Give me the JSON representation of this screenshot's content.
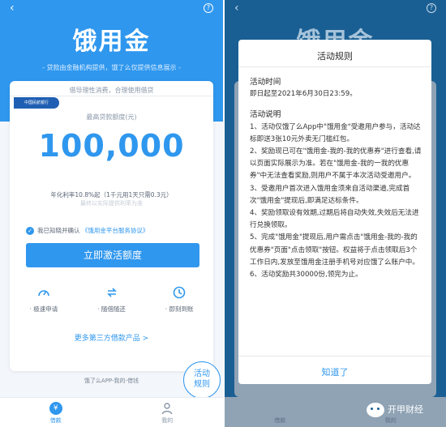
{
  "left": {
    "back_glyph": "‹",
    "help_glyph": "?",
    "app_name": "饿用金",
    "tagline": "- 贷款由金融机构提供，饿了么仅提供信息展示 -",
    "card": {
      "header": "借导理性消费，合理使用借贷",
      "partner_badge": "中国民航银行",
      "limit_label": "最高贷款额度(元)",
      "limit_amount": "100,000",
      "rate_line": "年化利率10.8%起（1千元用1天只需0.3元）",
      "rate_note": "最终以实际提供利率为准",
      "agree_prefix": "我已知晓并确认",
      "agree_link": "《饿用金平台服务协议》",
      "activate_button": "立即激活额度",
      "features": [
        {
          "label": "· 极速申请",
          "icon": "speed-icon"
        },
        {
          "label": "· 随借随还",
          "icon": "repeat-icon"
        },
        {
          "label": "· 即刻到账",
          "icon": "clock-icon"
        }
      ],
      "more_link": "更多第三方借款产品 >"
    },
    "footer_note": "饿了么APP-我的-借钱",
    "float_button": {
      "line1": "活动",
      "line2": "规则"
    },
    "tabs": [
      {
        "label": "借款",
        "icon": "yen-icon",
        "active": true
      },
      {
        "label": "我的",
        "icon": "person-icon",
        "active": false
      }
    ]
  },
  "right": {
    "back_glyph": "‹",
    "help_glyph": "?",
    "app_name": "饿用金",
    "tabs": [
      "借款",
      "我的"
    ],
    "modal": {
      "title": "活动规则",
      "time_title": "活动时间",
      "time_text": "即日起至2021年6月30日23:59。",
      "rules_title": "活动说明",
      "rules": [
        "1、活动仅饿了么App中\"饿用金\"受邀用户参与，活动达标即送3张10元外卖无门槛红包。",
        "2、奖励现已可在\"饿用金-我的-我的优惠券\"进行查看,请以页面实际展示为准。若在\"饿用金-我的一我的优惠券\"中无法查看奖励,则用户不属于本次活动受邀用户。",
        "3、受邀用户首次进入饿用金须来自活动渠道,完成首次\"饿用金\"提现后,即满足达标条件。",
        "4、奖励领取设有效期,过期后将自动失效,失效后无法进行兑换领取。",
        "5、完成\"饿用金\"提现后,用户需点击\"饿用金-我的-我的优惠券\"页面\"点击领取\"按钮。权益将于点击领取后3个工作日内,发放至饿用金注册手机号对应饿了么账户中。",
        "6、活动奖励共30000份,领完为止。"
      ],
      "confirm_button": "知道了"
    },
    "watermark": "开甲财经"
  },
  "colors": {
    "accent": "#2f97ee",
    "overlay": "#1a5f93"
  }
}
